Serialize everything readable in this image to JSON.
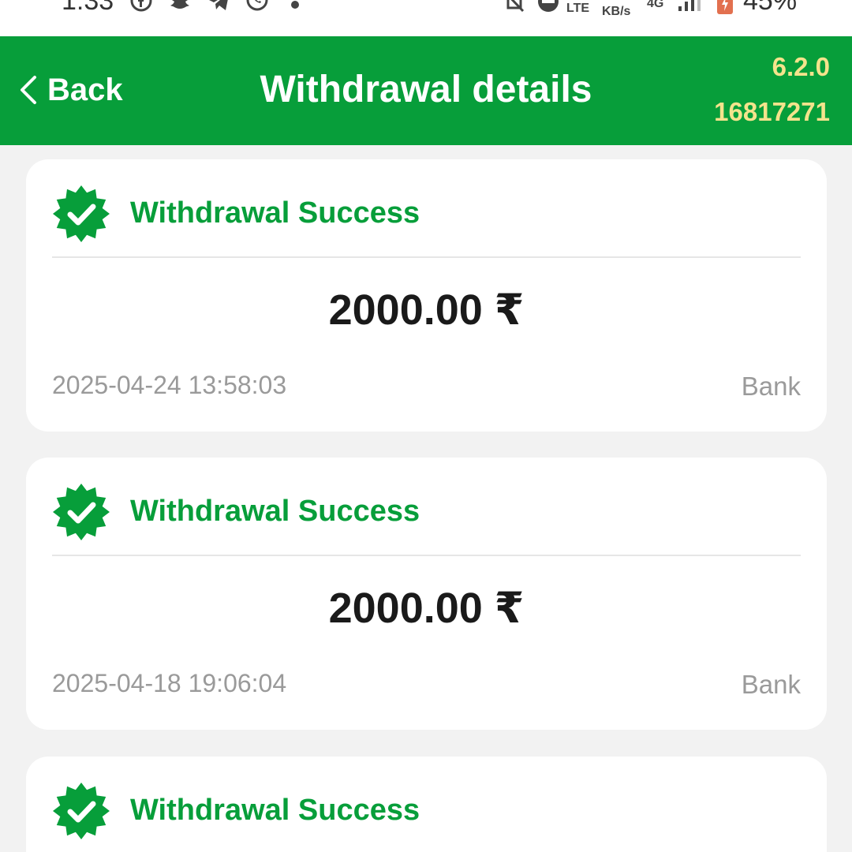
{
  "status_bar": {
    "time": "1:33",
    "lte_label": "LTE",
    "speed_label": "KB/s",
    "network_label": "4G",
    "battery": "45%"
  },
  "header": {
    "back_label": "Back",
    "title": "Withdrawal details",
    "version": "6.2.0",
    "user_id": "16817271",
    "background_color": "#079e3a",
    "accent_text_color": "#f4e38c"
  },
  "withdrawals": [
    {
      "status": "Withdrawal Success",
      "amount": "2000.00 ₹",
      "date": "2025-04-24 13:58:03",
      "method": "Bank"
    },
    {
      "status": "Withdrawal Success",
      "amount": "2000.00 ₹",
      "date": "2025-04-18 19:06:04",
      "method": "Bank"
    },
    {
      "status": "Withdrawal Success"
    }
  ],
  "icons": {
    "status_badge": "verified-check-badge-icon",
    "back": "chevron-left-icon"
  }
}
